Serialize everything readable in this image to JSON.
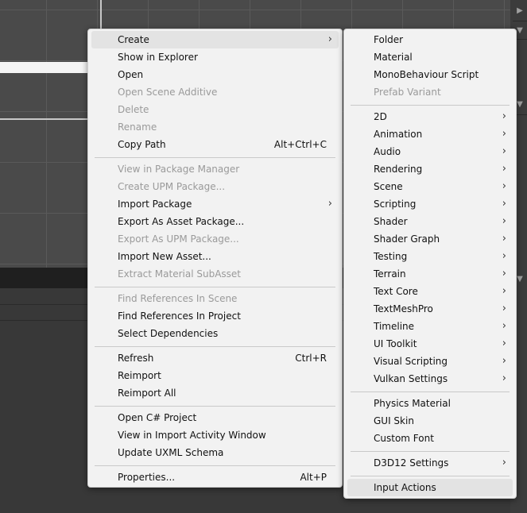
{
  "main_menu": {
    "items": [
      {
        "label": "Create",
        "arrow": "›"
      },
      {
        "label": "Show in Explorer"
      },
      {
        "label": "Open"
      },
      {
        "label": "Open Scene Additive"
      },
      {
        "label": "Delete"
      },
      {
        "label": "Rename"
      },
      {
        "label": "Copy Path",
        "shortcut": "Alt+Ctrl+C"
      },
      {
        "label": "View in Package Manager"
      },
      {
        "label": "Create UPM Package..."
      },
      {
        "label": "Import Package",
        "arrow": "›"
      },
      {
        "label": "Export As Asset Package..."
      },
      {
        "label": "Export As UPM Package..."
      },
      {
        "label": "Import New Asset..."
      },
      {
        "label": "Extract Material SubAsset"
      },
      {
        "label": "Find References In Scene"
      },
      {
        "label": "Find References In Project"
      },
      {
        "label": "Select Dependencies"
      },
      {
        "label": "Refresh",
        "shortcut": "Ctrl+R"
      },
      {
        "label": "Reimport"
      },
      {
        "label": "Reimport All"
      },
      {
        "label": "Open C# Project"
      },
      {
        "label": "View in Import Activity Window"
      },
      {
        "label": "Update UXML Schema"
      },
      {
        "label": "Properties...",
        "shortcut": "Alt+P"
      }
    ]
  },
  "create_submenu": {
    "items": [
      {
        "label": "Folder"
      },
      {
        "label": "Material"
      },
      {
        "label": "MonoBehaviour Script"
      },
      {
        "label": "Prefab Variant"
      },
      {
        "label": "2D",
        "arrow": "›"
      },
      {
        "label": "Animation",
        "arrow": "›"
      },
      {
        "label": "Audio",
        "arrow": "›"
      },
      {
        "label": "Rendering",
        "arrow": "›"
      },
      {
        "label": "Scene",
        "arrow": "›"
      },
      {
        "label": "Scripting",
        "arrow": "›"
      },
      {
        "label": "Shader",
        "arrow": "›"
      },
      {
        "label": "Shader Graph",
        "arrow": "›"
      },
      {
        "label": "Testing",
        "arrow": "›"
      },
      {
        "label": "Terrain",
        "arrow": "›"
      },
      {
        "label": "Text Core",
        "arrow": "›"
      },
      {
        "label": "TextMeshPro",
        "arrow": "›"
      },
      {
        "label": "Timeline",
        "arrow": "›"
      },
      {
        "label": "UI Toolkit",
        "arrow": "›"
      },
      {
        "label": "Visual Scripting",
        "arrow": "›"
      },
      {
        "label": "Vulkan Settings",
        "arrow": "›"
      },
      {
        "label": "Physics Material"
      },
      {
        "label": "GUI Skin"
      },
      {
        "label": "Custom Font"
      },
      {
        "label": "D3D12 Settings",
        "arrow": "›"
      },
      {
        "label": "Input Actions"
      }
    ]
  },
  "strip": {
    "play": "▶",
    "down1": "▼",
    "down2": "▼",
    "down3": "▼"
  },
  "colors": {
    "menu_bg": "#f2f2f2",
    "disabled_text": "#9a9a9a",
    "hover_bg": "#e3e3e3"
  }
}
